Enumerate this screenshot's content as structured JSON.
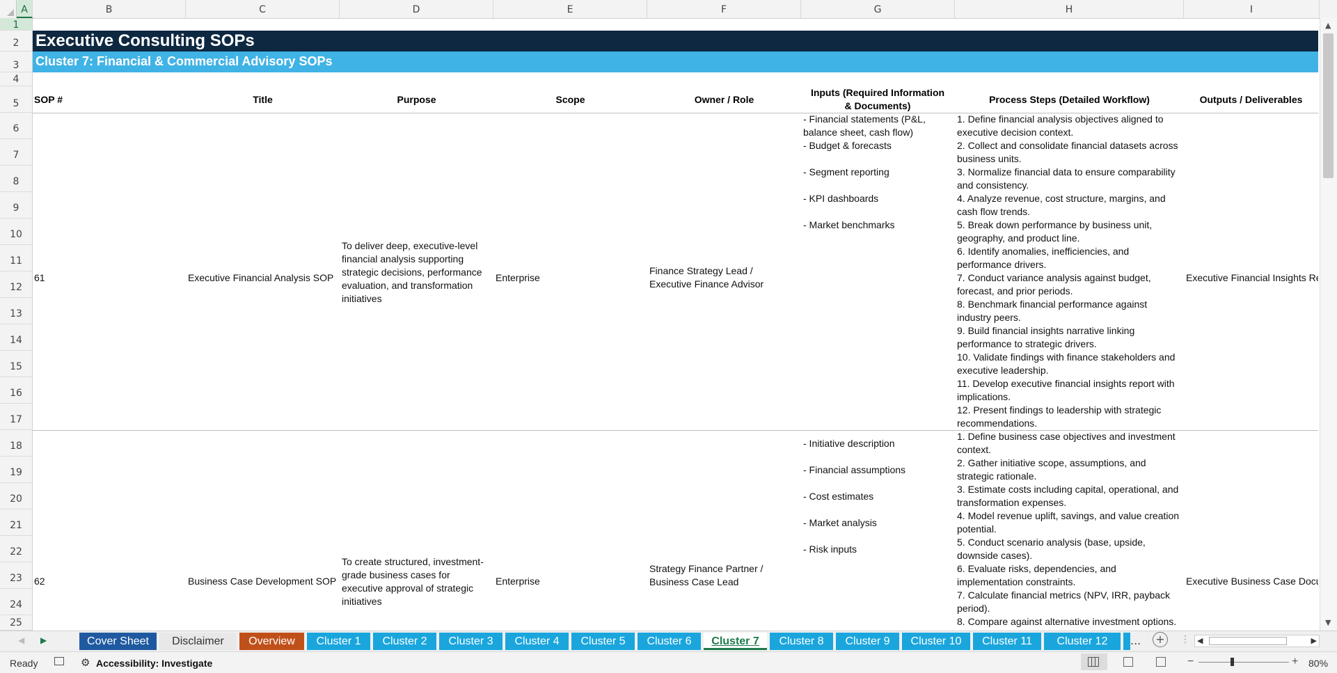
{
  "columns": [
    "A",
    "B",
    "C",
    "D",
    "E",
    "F",
    "G",
    "H",
    "I"
  ],
  "active_column": "A",
  "rows": [
    "1",
    "2",
    "3",
    "4",
    "5",
    "6",
    "7",
    "8",
    "9",
    "10",
    "11",
    "12",
    "13",
    "14",
    "15",
    "16",
    "17",
    "18",
    "19",
    "20",
    "21",
    "22",
    "23",
    "24",
    "25"
  ],
  "sheet": {
    "title": "Executive Consulting SOPs",
    "subtitle": "Cluster 7: Financial & Commercial Advisory SOPs",
    "title_bg": "#0e2841",
    "subtitle_bg": "#40b3e6",
    "headers": {
      "sop": "SOP #",
      "title": "Title",
      "purpose": "Purpose",
      "scope": "Scope",
      "owner": "Owner / Role",
      "inputs": "Inputs (Required Information & Documents)",
      "steps": "Process Steps (Detailed Workflow)",
      "outputs": "Outputs / Deliverables"
    },
    "records": [
      {
        "sop": "61",
        "title": "Executive Financial Analysis SOP",
        "purpose": "To deliver deep, executive-level financial analysis supporting strategic decisions, performance evaluation, and transformation initiatives",
        "scope": "Enterprise",
        "owner": "Finance Strategy Lead / Executive Finance Advisor",
        "inputs": [
          "- Financial statements (P&L, balance sheet, cash flow)",
          "- Budget & forecasts",
          "- Segment reporting",
          "- KPI dashboards",
          "- Market benchmarks"
        ],
        "steps": [
          "1. Define financial analysis objectives aligned to executive decision context.",
          "2. Collect and consolidate financial datasets across business units.",
          "3. Normalize financial data to ensure comparability and consistency.",
          "4. Analyze revenue, cost structure, margins, and cash flow trends.",
          "5. Break down performance by business unit, geography, and product line.",
          "6. Identify anomalies, inefficiencies, and performance drivers.",
          "7. Conduct variance analysis against budget, forecast, and prior periods.",
          "8. Benchmark financial performance against industry peers.",
          "9. Build financial insights narrative linking performance to strategic drivers.",
          "10. Validate findings with finance stakeholders and executive leadership.",
          "11. Develop executive financial insights report with implications.",
          "12. Present findings to leadership with strategic recommendations."
        ],
        "outputs": "Executive Financial Insights Rep"
      },
      {
        "sop": "62",
        "title": "Business Case Development SOP",
        "purpose": "To create structured, investment-grade business cases for executive approval of strategic initiatives",
        "scope": "Enterprise",
        "owner": "Strategy Finance Partner / Business Case Lead",
        "inputs": [
          "- Initiative description",
          "- Financial assumptions",
          "- Cost estimates",
          "- Market analysis",
          "- Risk inputs"
        ],
        "steps": [
          "1. Define business case objectives and investment context.",
          "2. Gather initiative scope, assumptions, and strategic rationale.",
          "3. Estimate costs including capital, operational, and transformation expenses.",
          "4. Model revenue uplift, savings, and value creation potential.",
          "5. Conduct scenario analysis (base, upside, downside cases).",
          "6. Evaluate risks, dependencies, and implementation constraints.",
          "7. Calculate financial metrics (NPV, IRR, payback period).",
          "8. Compare against alternative investment options."
        ],
        "outputs": "Executive Business Case Docum"
      }
    ]
  },
  "tabs": [
    {
      "label": "Cover Sheet",
      "color": "#1f5aa0"
    },
    {
      "label": "Disclaimer",
      "color": "#e8e8e8",
      "text_color": "#333333"
    },
    {
      "label": "Overview",
      "color": "#c0501a"
    },
    {
      "label": "Cluster 1",
      "color": "#1aa6dd"
    },
    {
      "label": "Cluster 2",
      "color": "#1aa6dd"
    },
    {
      "label": "Cluster 3",
      "color": "#1aa6dd"
    },
    {
      "label": "Cluster 4",
      "color": "#1aa6dd"
    },
    {
      "label": "Cluster 5",
      "color": "#1aa6dd"
    },
    {
      "label": "Cluster 6",
      "color": "#1aa6dd"
    },
    {
      "label": "Cluster 7",
      "color": "#ffffff",
      "active": true
    },
    {
      "label": "Cluster 8",
      "color": "#1aa6dd"
    },
    {
      "label": "Cluster 9",
      "color": "#1aa6dd"
    },
    {
      "label": "Cluster 10",
      "color": "#1aa6dd"
    },
    {
      "label": "Cluster 11",
      "color": "#1aa6dd"
    },
    {
      "label": "Cluster 12",
      "color": "#1aa6dd"
    }
  ],
  "tab_more": "...",
  "status": {
    "ready": "Ready",
    "accessibility": "Accessibility: Investigate",
    "zoom": "80%"
  }
}
